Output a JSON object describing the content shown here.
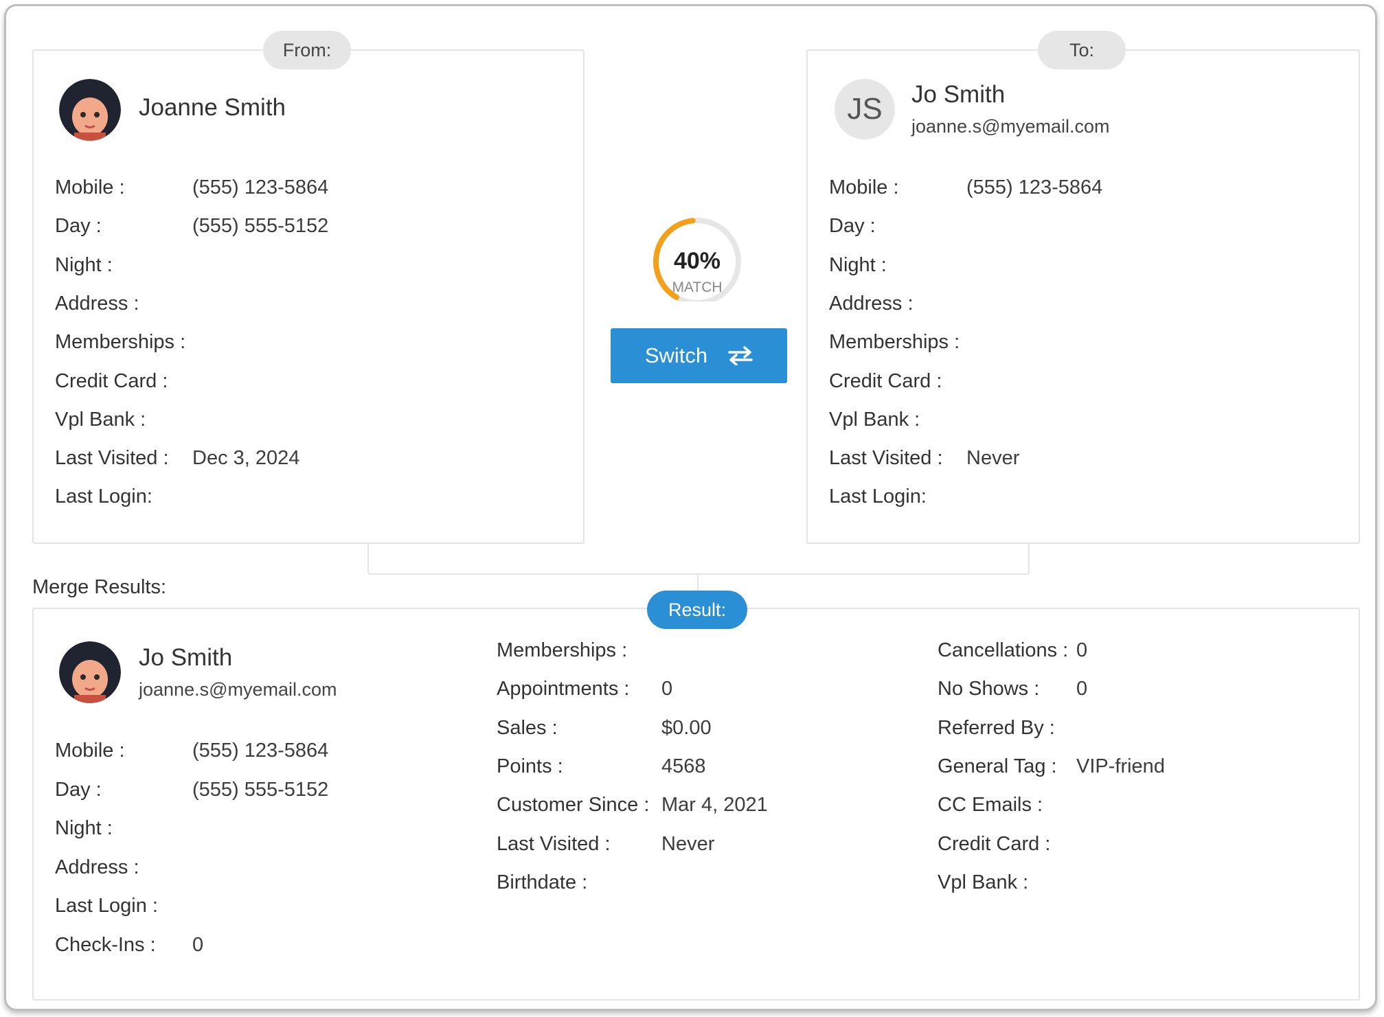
{
  "from": {
    "tag": "From:",
    "name": "Joanne Smith",
    "avatar_icon": "female-avatar-icon",
    "fields": [
      {
        "label": "Mobile :",
        "value": "(555) 123-5864"
      },
      {
        "label": "Day :",
        "value": "(555) 555-5152"
      },
      {
        "label": "Night :",
        "value": ""
      },
      {
        "label": "Address :",
        "value": ""
      },
      {
        "label": "Memberships :",
        "value": ""
      },
      {
        "label": "Credit Card :",
        "value": ""
      },
      {
        "label": "Vpl Bank :",
        "value": ""
      },
      {
        "label": "Last Visited :",
        "value": "Dec 3, 2024"
      },
      {
        "label": "Last Login:",
        "value": ""
      }
    ]
  },
  "to": {
    "tag": "To:",
    "initials": "JS",
    "name": "Jo Smith",
    "email": "joanne.s@myemail.com",
    "fields": [
      {
        "label": "Mobile :",
        "value": "(555) 123-5864"
      },
      {
        "label": "Day :",
        "value": ""
      },
      {
        "label": "Night :",
        "value": ""
      },
      {
        "label": "Address :",
        "value": ""
      },
      {
        "label": "Memberships :",
        "value": ""
      },
      {
        "label": "Credit Card :",
        "value": ""
      },
      {
        "label": "Vpl Bank :",
        "value": ""
      },
      {
        "label": "Last Visited :",
        "value": "Never"
      },
      {
        "label": "Last Login:",
        "value": ""
      }
    ]
  },
  "match": {
    "percent_label": "40%",
    "percent": 40,
    "sublabel": "MATCH",
    "color": "#f5a01a"
  },
  "switch_button": {
    "label": "Switch",
    "icon": "swap-arrows-icon"
  },
  "merge_results": {
    "title": "Merge Results:",
    "tag": "Result:",
    "name": "Jo Smith",
    "email": "joanne.s@myemail.com",
    "avatar_icon": "female-avatar-icon",
    "col1": [
      {
        "label": "Mobile :",
        "value": "(555) 123-5864"
      },
      {
        "label": "Day :",
        "value": "(555) 555-5152"
      },
      {
        "label": "Night :",
        "value": ""
      },
      {
        "label": "Address :",
        "value": ""
      },
      {
        "label": "Last Login :",
        "value": ""
      },
      {
        "label": "Check-Ins :",
        "value": "0"
      }
    ],
    "col2": [
      {
        "label": "Memberships :",
        "value": ""
      },
      {
        "label": "Appointments :",
        "value": "0"
      },
      {
        "label": "Sales :",
        "value": "$0.00"
      },
      {
        "label": "Points :",
        "value": "4568"
      },
      {
        "label": "Customer Since :",
        "value": "Mar 4, 2021"
      },
      {
        "label": "Last Visited :",
        "value": "Never"
      },
      {
        "label": "Birthdate :",
        "value": ""
      }
    ],
    "col3": [
      {
        "label": "Cancellations :",
        "value": "0"
      },
      {
        "label": "No Shows :",
        "value": "0"
      },
      {
        "label": "Referred By :",
        "value": ""
      },
      {
        "label": "General Tag :",
        "value": "VIP-friend"
      },
      {
        "label": "CC Emails :",
        "value": ""
      },
      {
        "label": "Credit Card :",
        "value": ""
      },
      {
        "label": "Vpl Bank :",
        "value": ""
      }
    ]
  },
  "colors": {
    "accent_blue": "#2b8fd6",
    "pill_gray": "#e6e6e6",
    "gauge_orange": "#f5a01a"
  }
}
